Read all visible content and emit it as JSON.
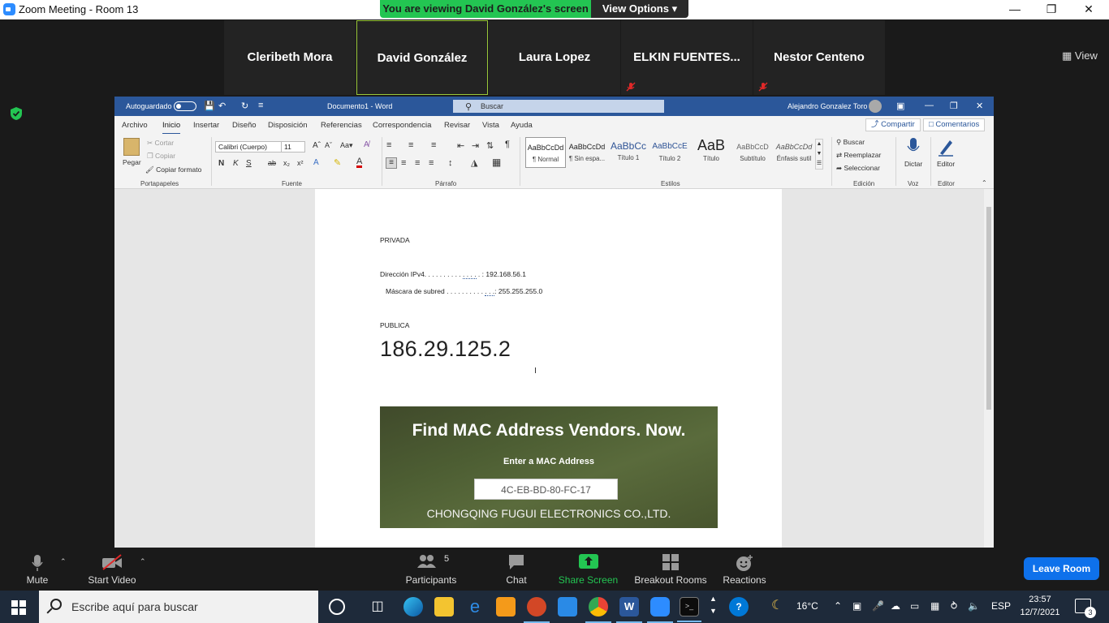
{
  "window": {
    "title": "Zoom Meeting - Room 13",
    "viewing_banner": "You are viewing David González's screen",
    "view_options": "View Options ▾",
    "minimize": "—",
    "maximize": "❐",
    "close": "✕"
  },
  "participants": [
    {
      "name": "Cleribeth Mora",
      "muted": false,
      "active": false
    },
    {
      "name": "David González",
      "muted": false,
      "active": true
    },
    {
      "name": "Laura Lopez",
      "muted": false,
      "active": false
    },
    {
      "name": "ELKIN  FUENTES...",
      "muted": true,
      "active": false
    },
    {
      "name": "Nestor Centeno",
      "muted": true,
      "active": false
    }
  ],
  "view_button": "View",
  "word": {
    "autosave": "Autoguardado",
    "document_title": "Documento1 - Word",
    "search_placeholder": "Buscar",
    "user_name": "Alejandro Gonzalez Toro",
    "tabs": [
      "Archivo",
      "Inicio",
      "Insertar",
      "Diseño",
      "Disposición",
      "Referencias",
      "Correspondencia",
      "Revisar",
      "Vista",
      "Ayuda"
    ],
    "selected_tab": "Inicio",
    "share": "Compartir",
    "comments": "Comentarios",
    "ribbon": {
      "paste": "Pegar",
      "cut": "Cortar",
      "copy": "Copiar",
      "format_painter": "Copiar formato",
      "font_name": "Calibri (Cuerpo)",
      "font_size": "11",
      "styles": [
        {
          "sample": "AaBbCcDd",
          "name": "¶ Normal"
        },
        {
          "sample": "AaBbCcDd",
          "name": "¶ Sin espa..."
        },
        {
          "sample": "AaBbCc",
          "name": "Título 1"
        },
        {
          "sample": "AaBbCcE",
          "name": "Título 2"
        },
        {
          "sample": "AaB",
          "name": "Título"
        },
        {
          "sample": "AaBbCcD",
          "name": "Subtítulo"
        },
        {
          "sample": "AaBbCcDd",
          "name": "Énfasis sutil"
        }
      ],
      "find": "Buscar",
      "replace": "Reemplazar",
      "select": "Seleccionar",
      "dictate": "Dictar",
      "editor": "Editor",
      "groups": {
        "clipboard": "Portapapeles",
        "font": "Fuente",
        "paragraph": "Párrafo",
        "styles": "Estilos",
        "editing": "Edición",
        "voice": "Voz",
        "editor": "Editor"
      }
    },
    "document": {
      "private_heading": "PRIVADA",
      "ipv4_label": "Dirección IPv4. . . . . . . . . . ",
      "ipv4_dots": ". . . .",
      "ipv4_value": " . : 192.168.56.1",
      "subnet_label": "Máscara de subred . . . . . . . . . . ",
      "subnet_dots": ". . .",
      "subnet_value": ": 255.255.255.0",
      "public_heading": "PUBLICA",
      "public_ip": "186.29.125.2",
      "mac_card": {
        "title": "Find MAC Address Vendors. Now.",
        "label": "Enter a MAC Address",
        "input_value": "4C-EB-BD-80-FC-17",
        "vendor": "CHONGQING FUGUI ELECTRONICS CO.,LTD."
      }
    }
  },
  "toolbar": {
    "mute": "Mute",
    "start_video": "Start Video",
    "participants": "Participants",
    "participants_count": "5",
    "chat": "Chat",
    "share_screen": "Share Screen",
    "breakout_rooms": "Breakout Rooms",
    "reactions": "Reactions",
    "leave": "Leave Room"
  },
  "taskbar": {
    "search_placeholder": "Escribe aquí para buscar",
    "weather": "16°C",
    "language": "ESP",
    "time": "23:57",
    "date": "12/7/2021",
    "notifications": "3"
  },
  "colors": {
    "zoom_green": "#23c552",
    "word_blue": "#2b579a",
    "leave_blue": "#0e71eb",
    "active_border": "#9ac83a",
    "mute_red": "#e02828"
  }
}
